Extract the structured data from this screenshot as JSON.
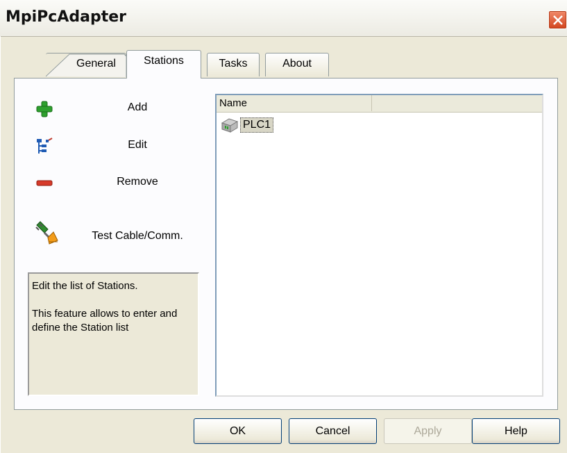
{
  "window": {
    "title": "MpiPcAdapter"
  },
  "tabs": [
    {
      "label": "General"
    },
    {
      "label": "Stations"
    },
    {
      "label": "Tasks"
    },
    {
      "label": "About"
    }
  ],
  "actions": {
    "add": {
      "label": "Add",
      "icon": "plus-icon"
    },
    "edit": {
      "label": "Edit",
      "icon": "tree-edit-icon"
    },
    "remove": {
      "label": "Remove",
      "icon": "minus-icon"
    },
    "test": {
      "label": "Test Cable/Comm.",
      "icon": "plug-icon"
    }
  },
  "description": {
    "line1": "Edit the list of Stations.",
    "line2": "This feature allows to enter and define the Station list"
  },
  "station_list": {
    "columns": [
      "Name",
      ""
    ],
    "items": [
      {
        "name": "PLC1",
        "icon": "plc-station-icon"
      }
    ]
  },
  "buttons": {
    "ok": "OK",
    "cancel": "Cancel",
    "apply": "Apply",
    "help": "Help"
  },
  "colors": {
    "close": "#d2441e",
    "add": "#2ea02e",
    "remove": "#d63a2a",
    "edit": "#1f5bb4"
  }
}
